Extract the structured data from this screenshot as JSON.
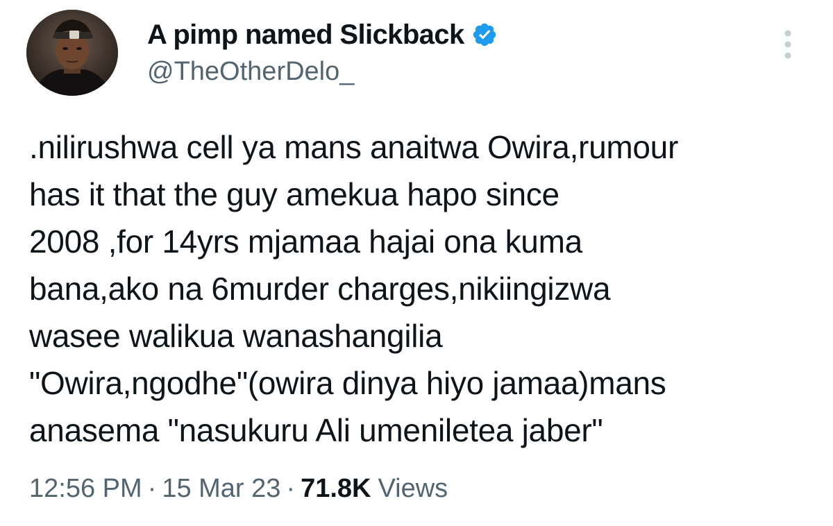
{
  "author": {
    "name": "A pimp named Slickback",
    "handle": "@TheOtherDelo_",
    "verified": true,
    "avatar_icon": "profile-photo",
    "verified_icon": "verified-check-icon"
  },
  "tweet": {
    "text": ".nilirushwa cell ya mans anaitwa Owira,rumour\nhas it that the guy amekua hapo since\n2008 ,for 14yrs mjamaa hajai ona kuma\nbana,ako na 6murder charges,nikiingizwa\nwasee walikua wanashangilia\n\"Owira,ngodhe\"(owira dinya hiyo jamaa)mans\nanasema \"nasukuru Ali umeniletea jaber\""
  },
  "meta": {
    "time": "12:56 PM",
    "separator": "·",
    "date": "15 Mar 23",
    "views_count": "71.8K",
    "views_label": "Views"
  },
  "colors": {
    "text_primary": "#0f1419",
    "text_secondary": "#536471",
    "verified_blue": "#1d9bf0",
    "more_dots": "#c4cfd6"
  }
}
